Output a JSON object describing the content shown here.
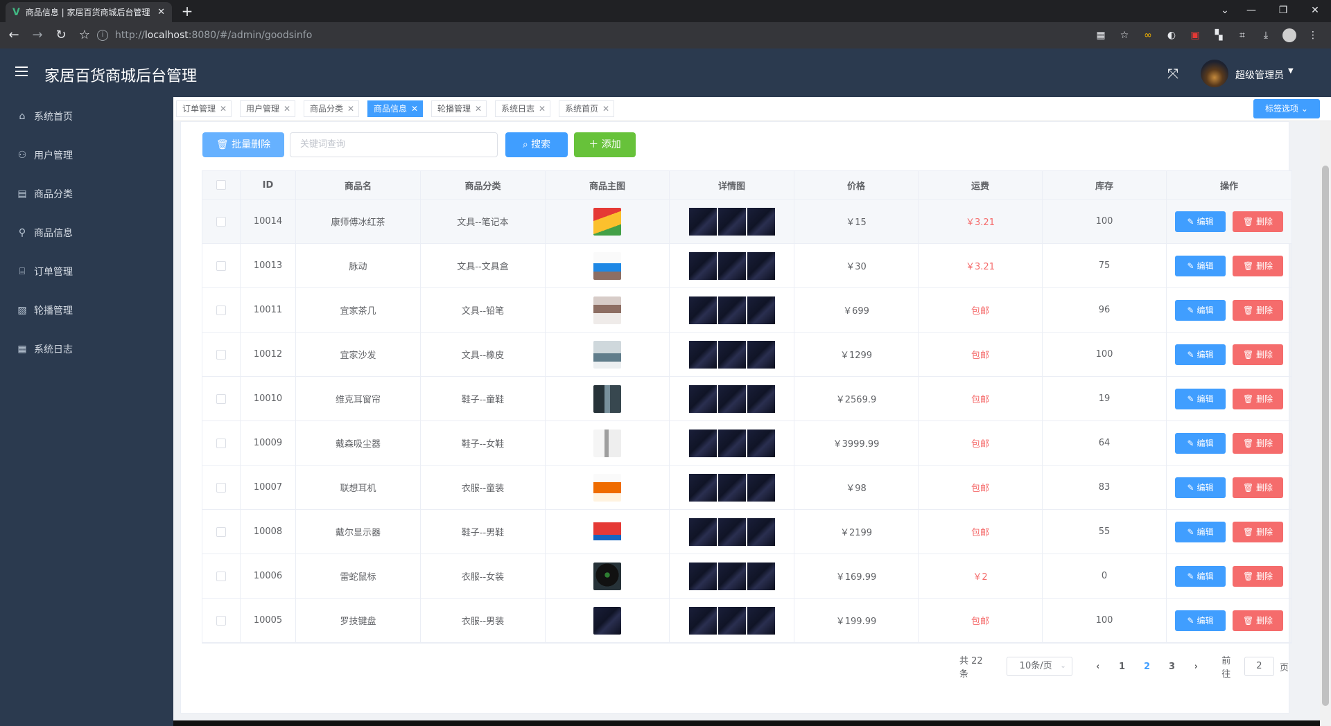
{
  "browser": {
    "tab_title": "商品信息 | 家居百货商城后台管理",
    "url_scheme": "http://",
    "url_host": "localhost",
    "url_path": ":8080/#/admin/goodsinfo"
  },
  "header": {
    "title": "家居百货商城后台管理",
    "username": "超级管理员"
  },
  "sidebar": {
    "items": [
      {
        "label": "系统首页",
        "icon": "home-icon"
      },
      {
        "label": "用户管理",
        "icon": "user-icon"
      },
      {
        "label": "商品分类",
        "icon": "document-icon"
      },
      {
        "label": "商品信息",
        "icon": "link-icon"
      },
      {
        "label": "订单管理",
        "icon": "inbox-icon"
      },
      {
        "label": "轮播管理",
        "icon": "picture-icon"
      },
      {
        "label": "系统日志",
        "icon": "calendar-icon"
      }
    ]
  },
  "tags": {
    "items": [
      {
        "label": "订单管理",
        "active": false
      },
      {
        "label": "用户管理",
        "active": false
      },
      {
        "label": "商品分类",
        "active": false
      },
      {
        "label": "商品信息",
        "active": true
      },
      {
        "label": "轮播管理",
        "active": false
      },
      {
        "label": "系统日志",
        "active": false
      },
      {
        "label": "系统首页",
        "active": false
      }
    ],
    "options_label": "标签选项"
  },
  "toolbar": {
    "batch_delete": "批量删除",
    "search_placeholder": "关键词查询",
    "search": "搜索",
    "add": "添加"
  },
  "table": {
    "columns": [
      "ID",
      "商品名",
      "商品分类",
      "商品主图",
      "详情图",
      "价格",
      "运费",
      "库存",
      "操作"
    ],
    "edit_label": "编辑",
    "delete_label": "删除",
    "rows": [
      {
        "id": "10014",
        "name": "康师傅冰红茶",
        "category": "文具--笔记本",
        "price": "￥15",
        "shipping": "￥3.21",
        "stock": "100",
        "img": "tea"
      },
      {
        "id": "10013",
        "name": "脉动",
        "category": "文具--文具盒",
        "price": "￥30",
        "shipping": "￥3.21",
        "stock": "75",
        "img": "drink"
      },
      {
        "id": "10011",
        "name": "宜家茶几",
        "category": "文具--铅笔",
        "price": "￥699",
        "shipping": "包邮",
        "stock": "96",
        "img": "table"
      },
      {
        "id": "10012",
        "name": "宜家沙发",
        "category": "文具--橡皮",
        "price": "￥1299",
        "shipping": "包邮",
        "stock": "100",
        "img": "sofa"
      },
      {
        "id": "10010",
        "name": "维克耳窗帘",
        "category": "鞋子--童鞋",
        "price": "￥2569.9",
        "shipping": "包邮",
        "stock": "19",
        "img": "curtain"
      },
      {
        "id": "10009",
        "name": "戴森吸尘器",
        "category": "鞋子--女鞋",
        "price": "￥3999.99",
        "shipping": "包邮",
        "stock": "64",
        "img": "vacuum"
      },
      {
        "id": "10007",
        "name": "联想耳机",
        "category": "衣服--童装",
        "price": "￥98",
        "shipping": "包邮",
        "stock": "83",
        "img": "earphone"
      },
      {
        "id": "10008",
        "name": "戴尔显示器",
        "category": "鞋子--男鞋",
        "price": "￥2199",
        "shipping": "包邮",
        "stock": "55",
        "img": "monitor"
      },
      {
        "id": "10006",
        "name": "雷蛇鼠标",
        "category": "衣服--女装",
        "price": "￥169.99",
        "shipping": "￥2",
        "stock": "0",
        "img": "mouse"
      },
      {
        "id": "10005",
        "name": "罗技键盘",
        "category": "衣服--男装",
        "price": "￥199.99",
        "shipping": "包邮",
        "stock": "100",
        "img": "keyboard"
      }
    ]
  },
  "pagination": {
    "total": "共 22 条",
    "page_size": "10条/页",
    "pages": [
      "1",
      "2",
      "3"
    ],
    "current": "2",
    "goto_prefix": "前往",
    "goto_value": "2",
    "goto_suffix": "页"
  },
  "colors": {
    "primary": "#409eff",
    "success": "#67c23a",
    "danger": "#f56c6c",
    "sidebar_bg": "#2b3a4f"
  }
}
